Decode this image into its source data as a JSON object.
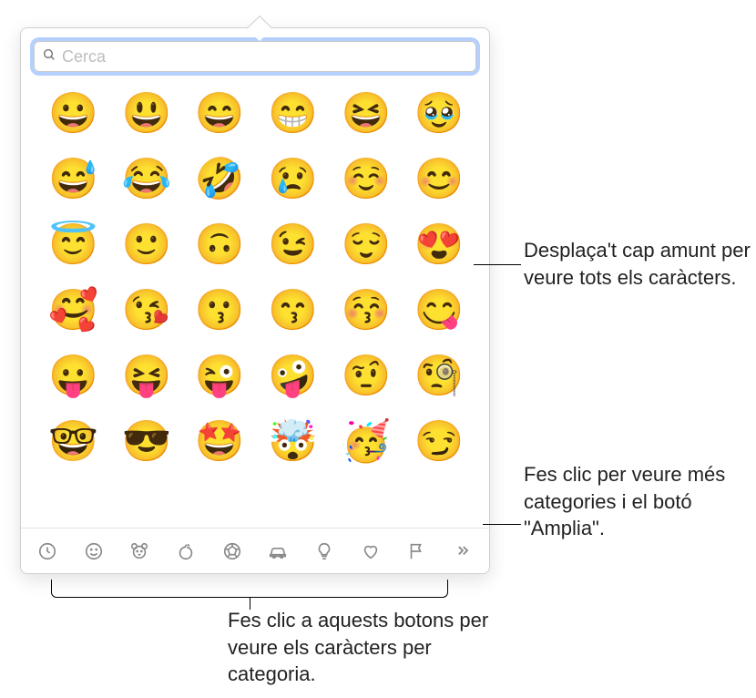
{
  "search": {
    "placeholder": "Cerca",
    "value": ""
  },
  "emojis": [
    "😀",
    "😃",
    "😄",
    "😁",
    "😆",
    "🥹",
    "😅",
    "😂",
    "🤣",
    "😢",
    "☺️",
    "😊",
    "😇",
    "🙂",
    "🙃",
    "😉",
    "😌",
    "😍",
    "🥰",
    "😘",
    "😗",
    "😙",
    "😚",
    "😋",
    "😛",
    "😝",
    "😜",
    "🤪",
    "🤨",
    "🧐",
    "🤓",
    "😎",
    "🤩",
    "🤯",
    "🥳",
    "😏"
  ],
  "categories": [
    {
      "name": "recent-icon"
    },
    {
      "name": "smileys-icon"
    },
    {
      "name": "animals-icon"
    },
    {
      "name": "food-icon"
    },
    {
      "name": "activity-icon"
    },
    {
      "name": "travel-icon"
    },
    {
      "name": "objects-icon"
    },
    {
      "name": "symbols-icon"
    },
    {
      "name": "flags-icon"
    },
    {
      "name": "expand-icon"
    }
  ],
  "callouts": {
    "scroll": "Desplaça't cap amunt per veure tots els caràcters.",
    "expand": "Fes clic per veure més categories i el botó \"Amplia\".",
    "categories": "Fes clic a aquests botons per veure els caràcters per categoria."
  }
}
